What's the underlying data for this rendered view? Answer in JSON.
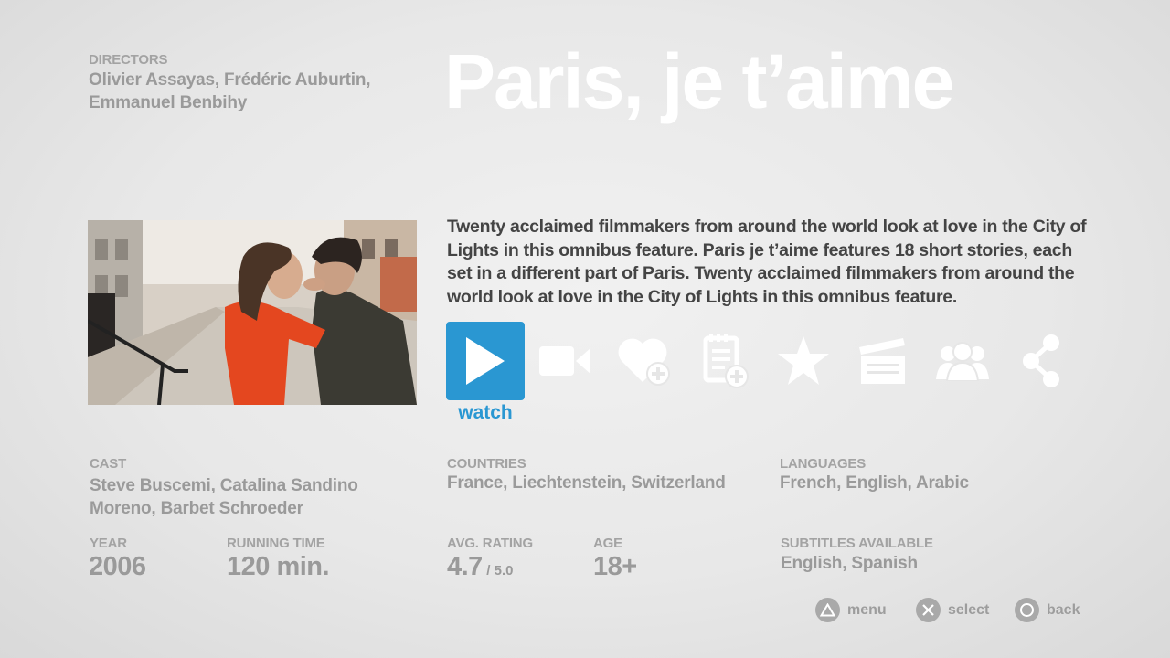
{
  "header": {
    "directors_label": "DIRECTORS",
    "directors": [
      "Olivier Assayas, Frédéric Auburtin,",
      "Emmanuel Benbihy"
    ],
    "title": "Paris, je t’aime"
  },
  "description": "Twenty acclaimed filmmakers from around the world look at love in the City of Lights in this omnibus feature. Paris je t’aime features 18 short stories, each set in a different part of Paris. Twenty acclaimed filmmakers from around the world look at love in the City of Lights in this omnibus feature.",
  "actions": {
    "watch_label": "watch",
    "icons": [
      "play-icon",
      "video-camera-icon",
      "heart-add-icon",
      "notes-add-icon",
      "star-icon",
      "clapperboard-icon",
      "people-icon",
      "share-icon"
    ]
  },
  "details": {
    "cast_label": "CAST",
    "cast": [
      "Steve Buscemi, Catalina Sandino",
      "Moreno, Barbet Schroeder"
    ],
    "countries_label": "COUNTRIES",
    "countries": "France, Liechtenstein, Switzerland",
    "languages_label": "LANGUAGES",
    "languages": "French, English, Arabic",
    "year_label": "YEAR",
    "year": "2006",
    "running_time_label": "RUNNING TIME",
    "running_time": "120 min.",
    "rating_label": "AVG. RATING",
    "rating": "4.7",
    "rating_max": "/ 5.0",
    "age_label": "AGE",
    "age": "18+",
    "subtitles_label": "SUBTITLES AVAILABLE",
    "subtitles": "English, Spanish"
  },
  "controls": {
    "menu": "menu",
    "select": "select",
    "back": "back"
  },
  "colors": {
    "accent": "#2a97d2",
    "title": "#ffffff",
    "description": "#444444",
    "muted": "#9a9a9a"
  }
}
